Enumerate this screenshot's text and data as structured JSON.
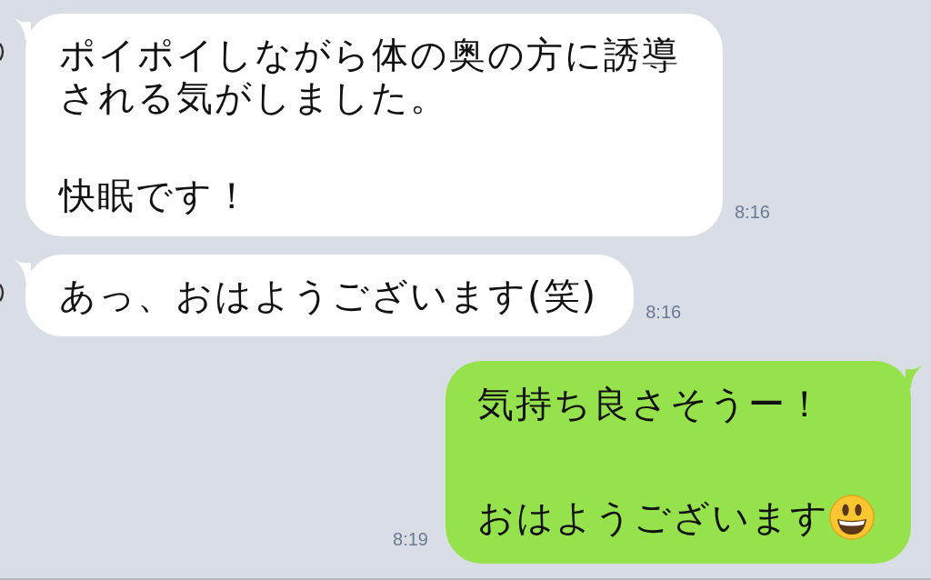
{
  "messages": [
    {
      "kind": "received",
      "paragraphs": [
        "ポイポイしながら体の奥の方に誘導される気がしました。",
        "快眠です！"
      ],
      "emoji": false,
      "time": "8:16"
    },
    {
      "kind": "received",
      "paragraphs": [
        "あっ、おはようございます(笑)"
      ],
      "emoji": false,
      "time": "8:16"
    },
    {
      "kind": "sent",
      "paragraphs": [
        "気持ち良さそうー！",
        "おはようございます"
      ],
      "emoji": true,
      "time": "8:19"
    }
  ]
}
